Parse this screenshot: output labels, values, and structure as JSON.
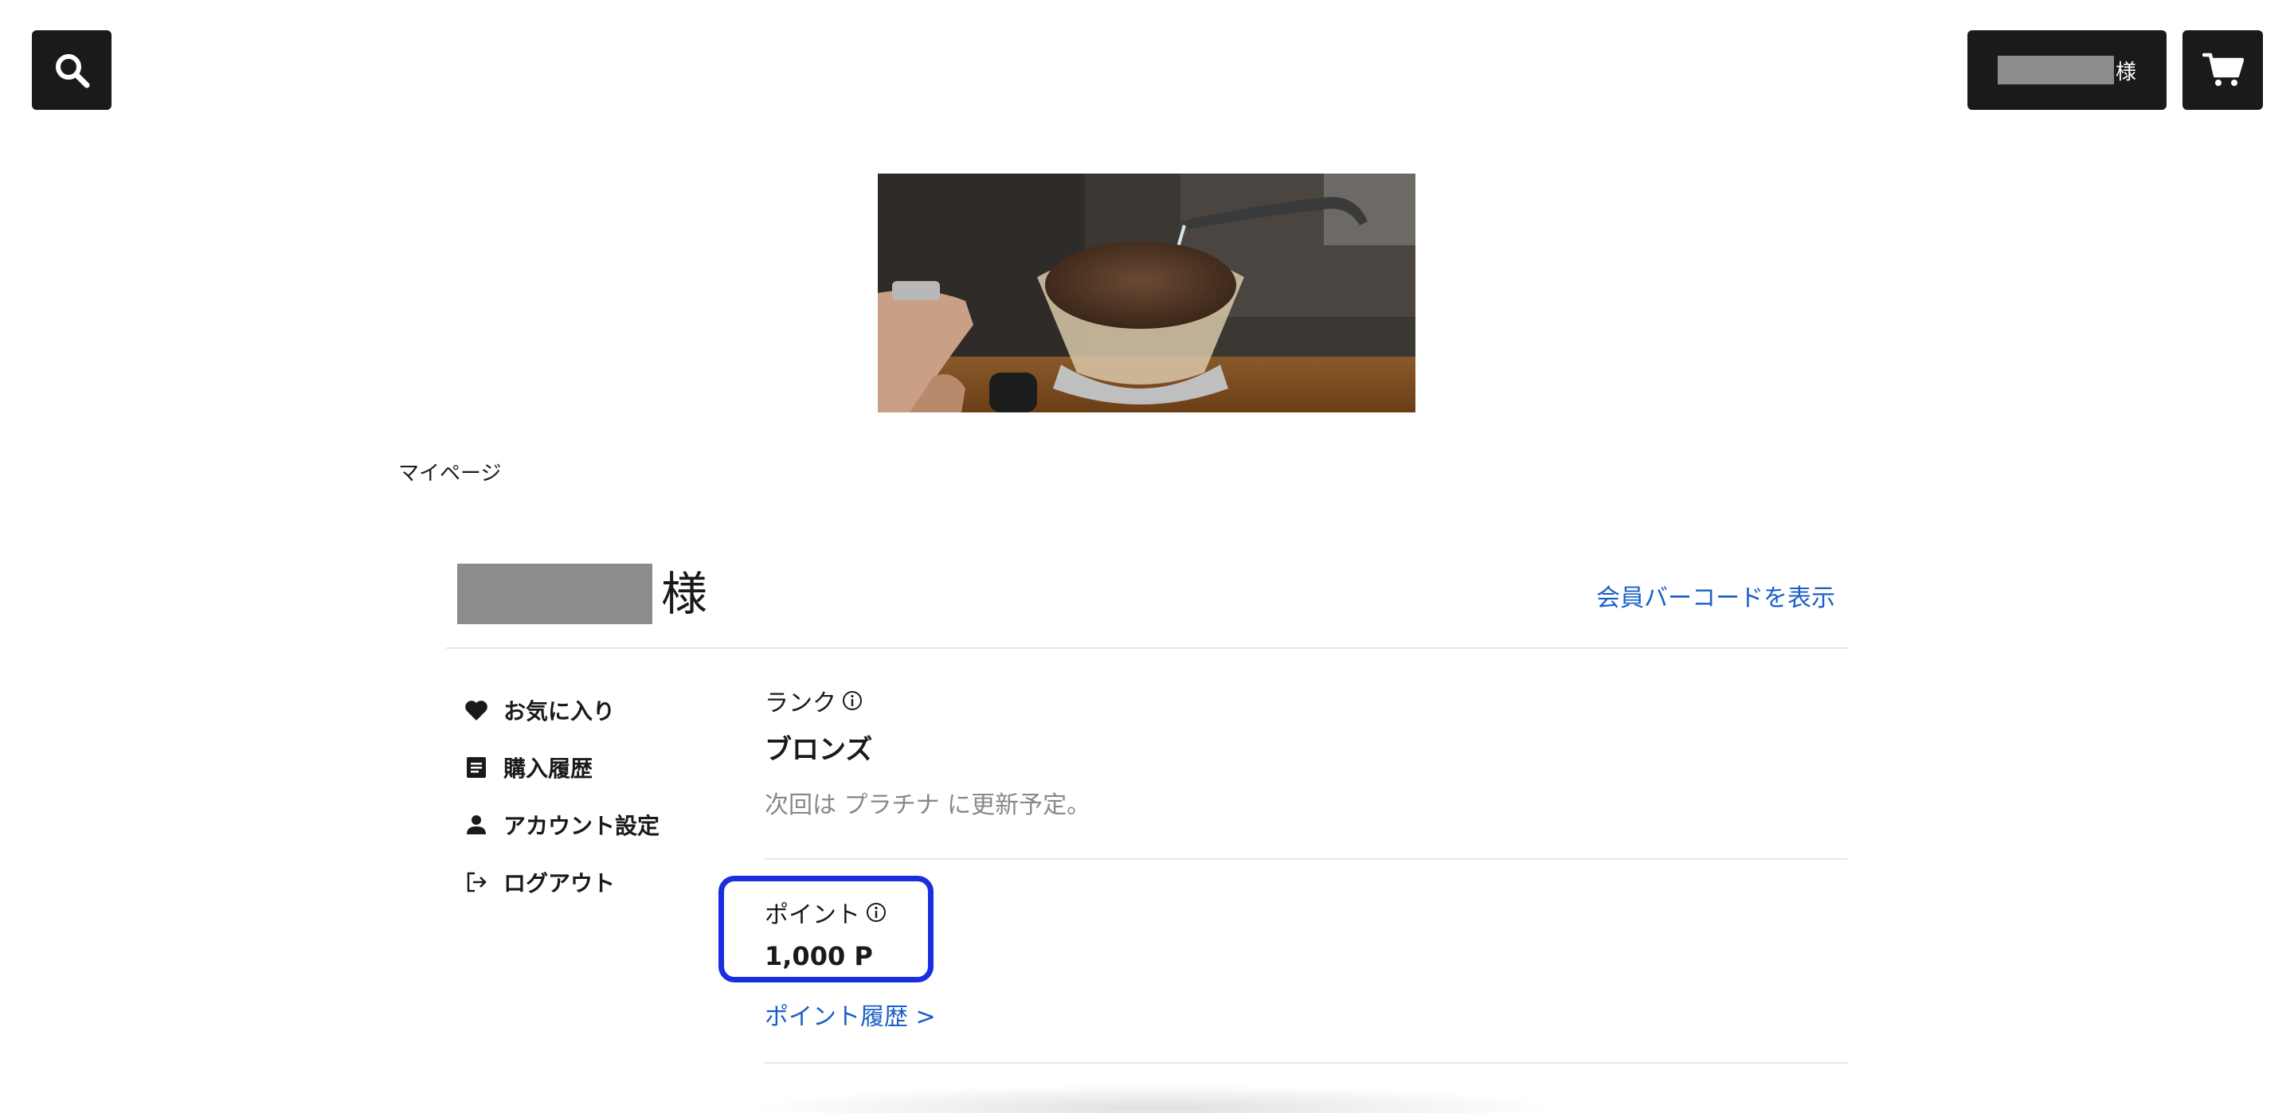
{
  "header": {
    "user_suffix": "様"
  },
  "breadcrumb": "マイページ",
  "member": {
    "name_suffix": "様",
    "barcode_link": "会員バーコードを表示"
  },
  "menu": {
    "items": [
      {
        "label": "お気に入り",
        "icon": "heart-icon"
      },
      {
        "label": "購入履歴",
        "icon": "document-icon"
      },
      {
        "label": "アカウント設定",
        "icon": "person-icon"
      },
      {
        "label": "ログアウト",
        "icon": "logout-icon"
      }
    ]
  },
  "rank": {
    "label": "ランク",
    "value": "ブロンズ",
    "note": "次回は プラチナ に更新予定。"
  },
  "points": {
    "label": "ポイント",
    "value": "1,000 P",
    "history_link": "ポイント履歴 >"
  },
  "colors": {
    "link": "#1a5fc7",
    "highlight": "#1a2ee0",
    "button_bg": "#1a1a1a"
  }
}
